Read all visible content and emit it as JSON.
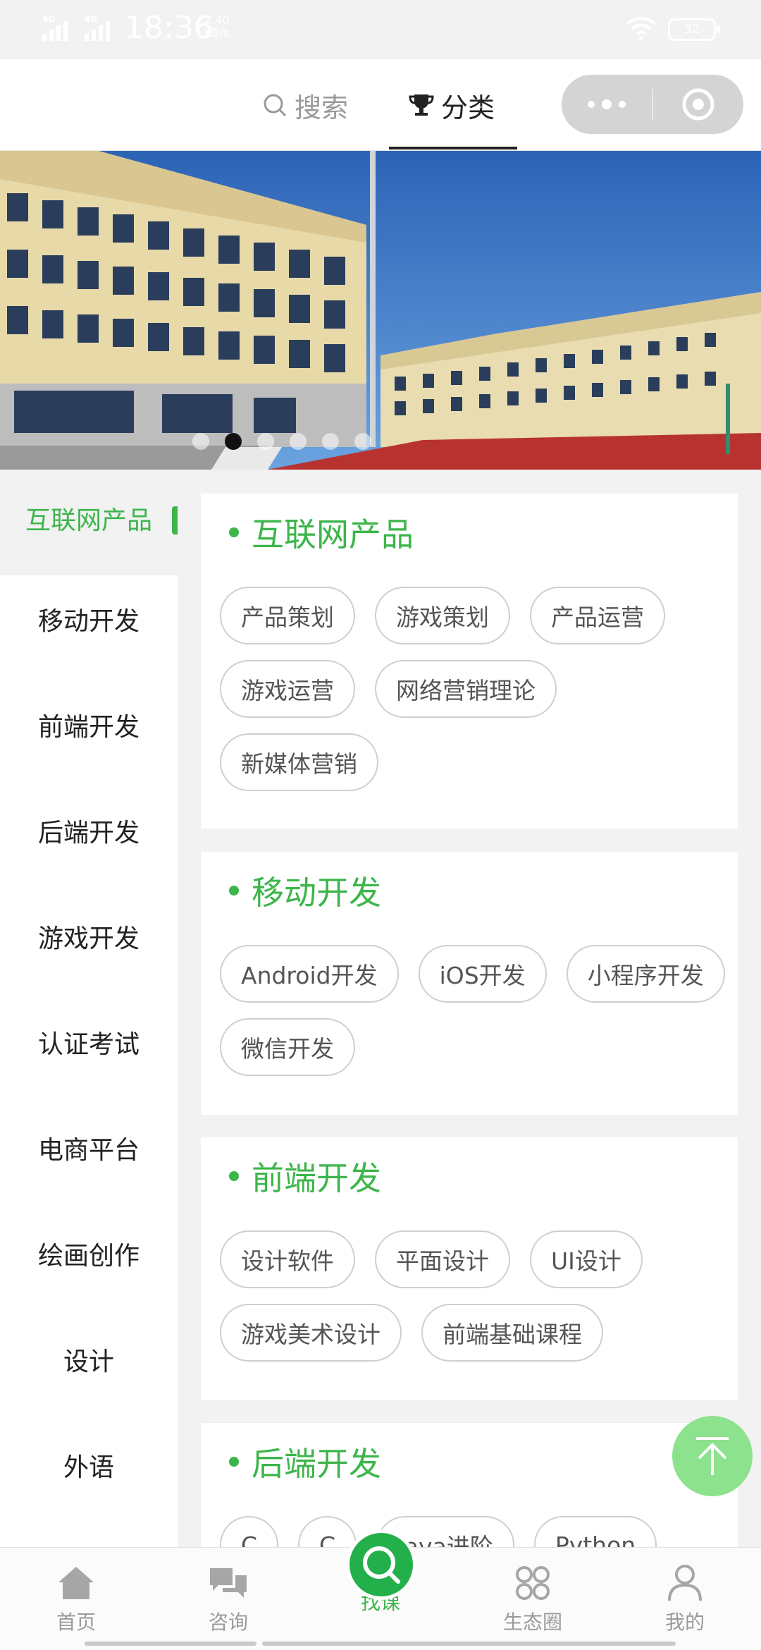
{
  "status_bar": {
    "network_1": "4G",
    "network_2": "4G",
    "time": "18:36",
    "speed_value": "2.40",
    "speed_unit": "KB/s",
    "battery": "32"
  },
  "header": {
    "search_label": "搜索",
    "category_label": "分类",
    "search_icon": "search-icon",
    "category_icon": "trophy-icon"
  },
  "banner": {
    "slide_count": 6,
    "active_slide": 2
  },
  "sidebar": {
    "items": [
      {
        "label": "互联网产品"
      },
      {
        "label": "移动开发"
      },
      {
        "label": "前端开发"
      },
      {
        "label": "后端开发"
      },
      {
        "label": "游戏开发"
      },
      {
        "label": "认证考试"
      },
      {
        "label": "电商平台"
      },
      {
        "label": "绘画创作"
      },
      {
        "label": "设计"
      },
      {
        "label": "外语"
      }
    ]
  },
  "sections": [
    {
      "title": "互联网产品",
      "tags": [
        {
          "label": "产品策划"
        },
        {
          "label": "游戏策划"
        },
        {
          "label": "产品运营"
        },
        {
          "label": "游戏运营"
        },
        {
          "label": "网络营销理论"
        },
        {
          "label": "新媒体营销"
        }
      ]
    },
    {
      "title": "移动开发",
      "tags": [
        {
          "label": "Android开发"
        },
        {
          "label": "iOS开发"
        },
        {
          "label": "小程序开发"
        },
        {
          "label": "微信开发"
        }
      ]
    },
    {
      "title": "前端开发",
      "tags": [
        {
          "label": "设计软件"
        },
        {
          "label": "平面设计"
        },
        {
          "label": "UI设计"
        },
        {
          "label": "游戏美术设计"
        },
        {
          "label": "前端基础课程"
        }
      ]
    },
    {
      "title": "后端开发",
      "tags": [
        {
          "label": "C"
        },
        {
          "label": "C"
        },
        {
          "label": "Java进阶"
        },
        {
          "label": "Python"
        }
      ]
    }
  ],
  "tabbar": {
    "items": [
      {
        "label": "首页",
        "icon": "home-icon"
      },
      {
        "label": "咨询",
        "icon": "chat-icon"
      },
      {
        "label": "找课",
        "icon": "search-icon"
      },
      {
        "label": "生态圈",
        "icon": "circles-icon"
      },
      {
        "label": "我的",
        "icon": "user-icon"
      }
    ]
  },
  "colors": {
    "accent": "#3cb54a",
    "backtop": "#8de28d",
    "background": "#f2f2f2"
  }
}
